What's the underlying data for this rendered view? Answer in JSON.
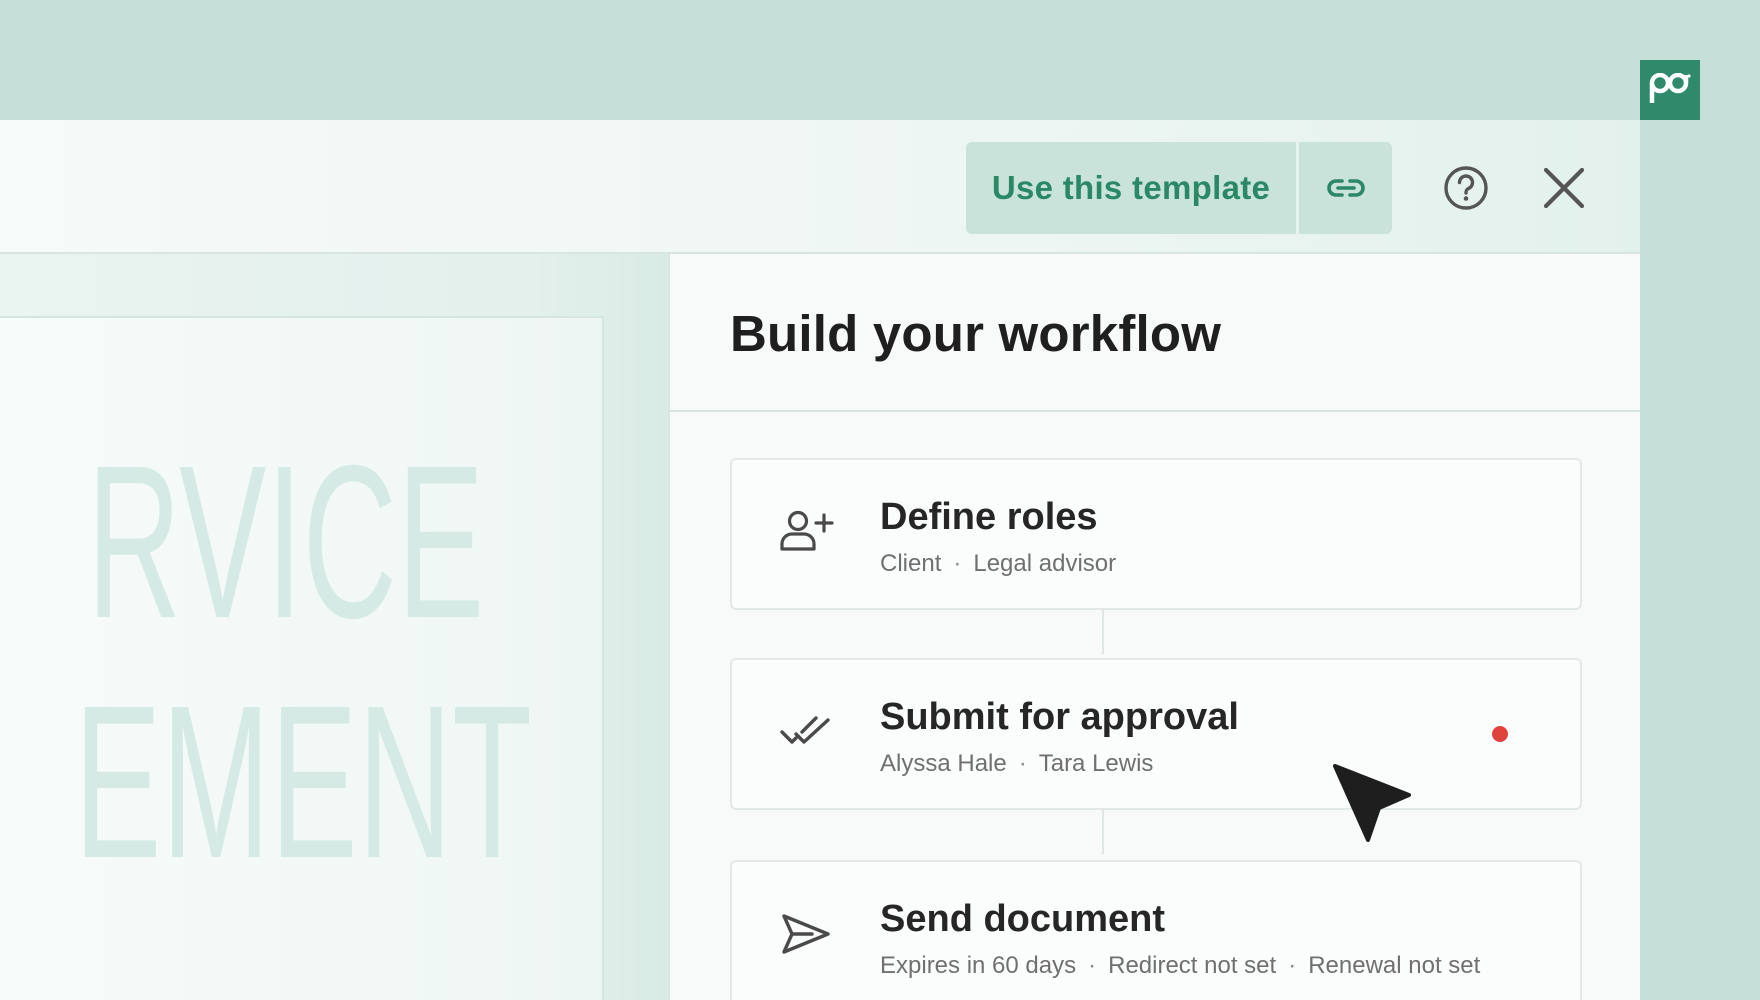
{
  "brand": {
    "logo_icon": "pandadoc-logo-icon",
    "color": "#2e8a6b"
  },
  "toolbar": {
    "use_template_label": "Use this template",
    "link_icon": "link-icon",
    "help_icon": "help-circle-icon",
    "close_icon": "close-icon",
    "accent_color": "#2a8866",
    "button_bg": "#c9e3db"
  },
  "document": {
    "visible_text_line1": "RVICE",
    "visible_text_line2": "EMENT"
  },
  "workflow": {
    "title": "Build your workflow",
    "steps": [
      {
        "icon": "add-user-icon",
        "title": "Define roles",
        "details": [
          "Client",
          "Legal advisor"
        ]
      },
      {
        "icon": "double-check-icon",
        "title": "Submit for approval",
        "details": [
          "Alyssa Hale",
          "Tara Lewis"
        ],
        "status_dot_color": "#e0433e"
      },
      {
        "icon": "send-icon",
        "title": "Send document",
        "details": [
          "Expires in 60 days",
          "Redirect not set",
          "Renewal not set"
        ]
      }
    ]
  },
  "cursor_icon": "mouse-pointer-icon"
}
